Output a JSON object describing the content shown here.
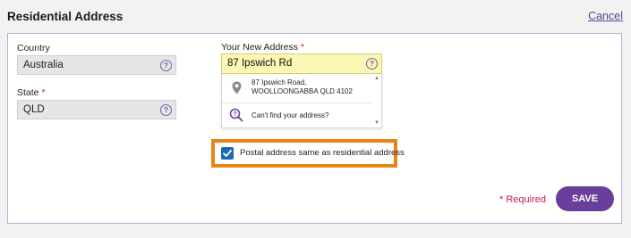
{
  "header": {
    "title": "Residential Address",
    "cancel_label": "Cancel"
  },
  "form": {
    "country": {
      "label": "Country",
      "value": "Australia"
    },
    "state": {
      "label": "State",
      "required_marker": "*",
      "value": "QLD"
    },
    "new_address": {
      "label": "Your New Address",
      "required_marker": "*",
      "value": "87 Ipswich Rd",
      "suggestions": [
        {
          "icon": "map-pin-icon",
          "line1": "87 Ipswich Road,",
          "line2": "WOOLLOONGABBA QLD 4102"
        },
        {
          "icon": "search-question-icon",
          "text": "Can't find your address?"
        }
      ]
    },
    "postal_same": {
      "label": "Postal address same as residential address",
      "checked": true
    },
    "help_icon_glyph": "?"
  },
  "footer": {
    "required_note": "* Required",
    "save_label": "SAVE"
  },
  "colors": {
    "accent": "#6a3f9b",
    "required": "#c8175d",
    "highlight": "#e8841a",
    "checkbox": "#1f67b3",
    "input_highlight": "#fbf7b5"
  }
}
